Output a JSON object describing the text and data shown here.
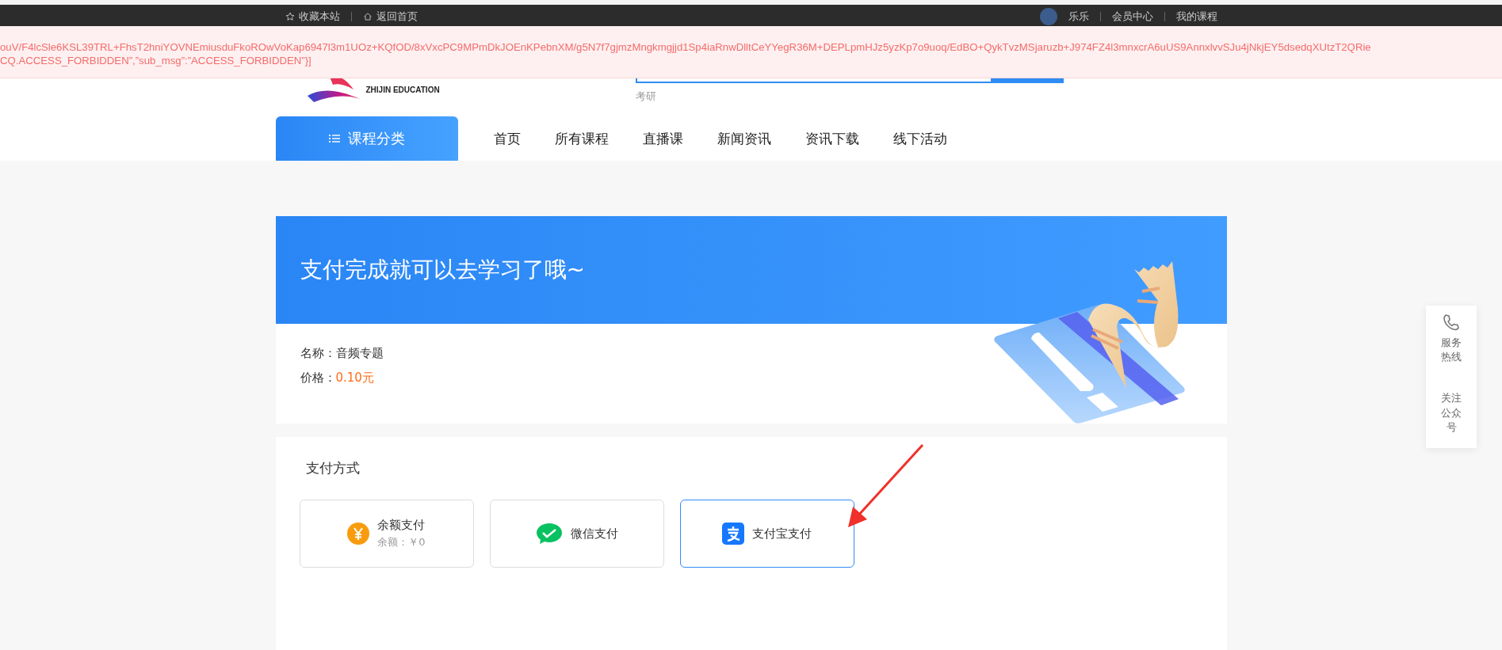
{
  "top_bar": {
    "links": [
      {
        "kind": "star",
        "label": "收藏本站"
      },
      {
        "kind": "home",
        "label": "返回首页"
      }
    ],
    "user_name": "乐乐",
    "user_links": [
      "会员中心",
      "我的课程"
    ]
  },
  "error_banner": {
    "lines": [
      "ouV/F4lcSle6KSL39TRL+FhsT2hniYOVNEmiusduFkoROwVoKap6947l3m1UOz+KQfOD/8xVxcPC9MPmDkJOEnKPebnXM/g5N7f7gjmzMngkmgjjd1Sp4iaRnwDlltCeYYegR36M+DEPLpmHJz5yzKp7o9uoq/EdBO+QykTvzMSjaruzb+J974FZ4l3mnxcrA6uUS9AnnxlvvSJu4jNkjEY5dsedqXUtzT2QRie",
      "CQ.ACCESS_FORBIDDEN”,”sub_msg”:”ACCESS_FORBIDDEN”}]"
    ]
  },
  "header": {
    "logo_text": "ZHIJIN EDUCATION",
    "hot_keywords": [
      "考研"
    ]
  },
  "nav": {
    "category_button": "课程分类",
    "items": [
      "首页",
      "所有课程",
      "直播课",
      "新闻资讯",
      "资讯下载",
      "线下活动"
    ]
  },
  "order": {
    "heading": "支付完成就可以去学习了哦~",
    "name_label": "名称：",
    "name": "音频专题",
    "price_label": "价格：",
    "price": "0.10元"
  },
  "payment": {
    "title": "支付方式",
    "methods": [
      {
        "kind": "balance",
        "label": "余额支付",
        "sub": "余额：￥0",
        "selected": false
      },
      {
        "kind": "wechat",
        "label": "微信支付",
        "selected": false
      },
      {
        "kind": "alipay",
        "label": "支付宝支付",
        "selected": true
      }
    ]
  },
  "side_widget": {
    "items": [
      {
        "kind": "phone",
        "label": "服务热线"
      },
      {
        "kind": "qrcode",
        "label": "关注公众号"
      }
    ]
  }
}
